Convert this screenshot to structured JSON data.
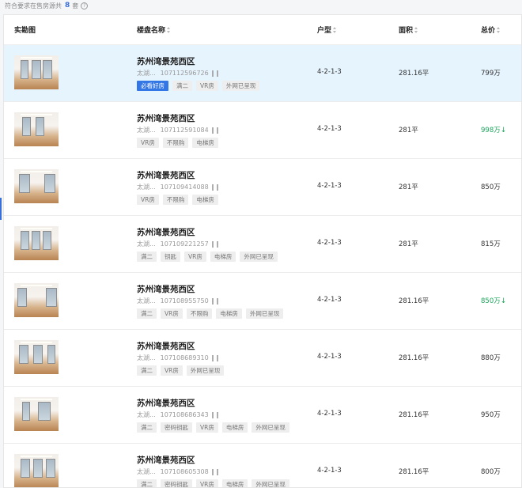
{
  "summary": {
    "prefix": "符合要求在售房源共",
    "count": "8",
    "suffix": "套"
  },
  "columns": {
    "photo": "实勘图",
    "name": "楼盘名称",
    "layout": "户型",
    "area": "面积",
    "price": "总价"
  },
  "rows": [
    {
      "name": "苏州湾景苑西区",
      "area_short": "太湖...",
      "id": "107112596726",
      "tags": [
        "必看好房",
        "满二",
        "VR房",
        "外网已呈现"
      ],
      "layout": "4-2-1-3",
      "area": "281.16平",
      "price": "799万",
      "price_down": false,
      "arrow": ""
    },
    {
      "name": "苏州湾景苑西区",
      "area_short": "太湖...",
      "id": "107112591084",
      "tags": [
        "VR房",
        "不限购",
        "电梯房"
      ],
      "layout": "4-2-1-3",
      "area": "281平",
      "price": "998万",
      "price_down": true,
      "arrow": "↓"
    },
    {
      "name": "苏州湾景苑西区",
      "area_short": "太湖...",
      "id": "107109414088",
      "tags": [
        "VR房",
        "不限购",
        "电梯房"
      ],
      "layout": "4-2-1-3",
      "area": "281平",
      "price": "850万",
      "price_down": false,
      "arrow": ""
    },
    {
      "name": "苏州湾景苑西区",
      "area_short": "太湖...",
      "id": "107109221257",
      "tags": [
        "满二",
        "钥匙",
        "VR房",
        "电梯房",
        "外网已呈现"
      ],
      "layout": "4-2-1-3",
      "area": "281平",
      "price": "815万",
      "price_down": false,
      "arrow": ""
    },
    {
      "name": "苏州湾景苑西区",
      "area_short": "太湖...",
      "id": "107108955750",
      "tags": [
        "满二",
        "VR房",
        "不限购",
        "电梯房",
        "外网已呈现"
      ],
      "layout": "4-2-1-3",
      "area": "281.16平",
      "price": "850万",
      "price_down": true,
      "arrow": "↓"
    },
    {
      "name": "苏州湾景苑西区",
      "area_short": "太湖...",
      "id": "107108689310",
      "tags": [
        "满二",
        "VR房",
        "外网已呈现"
      ],
      "layout": "4-2-1-3",
      "area": "281.16平",
      "price": "880万",
      "price_down": false,
      "arrow": ""
    },
    {
      "name": "苏州湾景苑西区",
      "area_short": "太湖...",
      "id": "107108686343",
      "tags": [
        "满二",
        "密码钥匙",
        "VR房",
        "电梯房",
        "外网已呈现"
      ],
      "layout": "4-2-1-3",
      "area": "281.16平",
      "price": "950万",
      "price_down": false,
      "arrow": ""
    },
    {
      "name": "苏州湾景苑西区",
      "area_short": "太湖...",
      "id": "107108605308",
      "tags": [
        "满二",
        "密码钥匙",
        "VR房",
        "电梯房",
        "外网已呈现"
      ],
      "layout": "4-2-1-3",
      "area": "281.16平",
      "price": "800万",
      "price_down": false,
      "arrow": ""
    }
  ],
  "colors": {
    "accent": "#3377e6",
    "price_down": "#1aa45b",
    "highlight_row": "#e6f4fe"
  }
}
